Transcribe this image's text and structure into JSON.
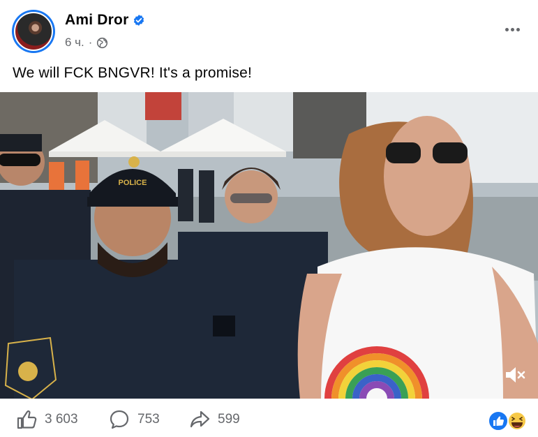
{
  "post": {
    "author": "Ami Dror",
    "time": "6 ч.",
    "separator": "·",
    "text": "We will FCK BNGVR! It's a promise!",
    "video": {
      "police_cap_text": "POLICE"
    }
  },
  "actions": {
    "likes": "3 603",
    "comments": "753",
    "shares": "599"
  },
  "colors": {
    "accent": "#1877f2",
    "secondary_text": "#65676b",
    "uniform": "#1e2838"
  },
  "icons": {
    "verified": "verified-badge-icon",
    "audience": "globe-icon",
    "more": "more-options-icon",
    "like": "thumbs-up-icon",
    "comment": "comment-icon",
    "share": "share-icon",
    "mute": "muted-speaker-icon",
    "reactions": [
      "like-reaction-icon",
      "haha-reaction-icon"
    ]
  }
}
